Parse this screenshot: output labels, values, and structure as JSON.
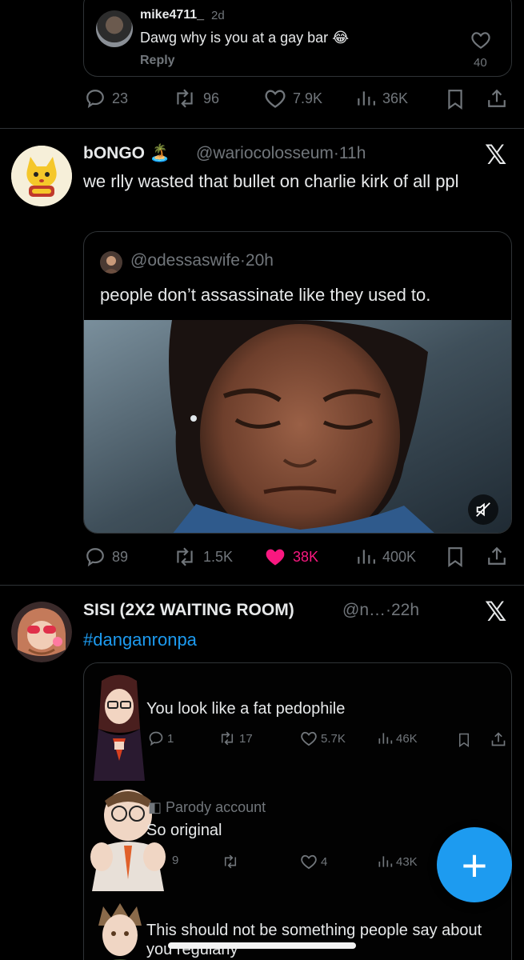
{
  "reply": {
    "username": "mike4711_",
    "time": "2d",
    "text": "Dawg why is you at a gay bar 😂",
    "reply_label": "Reply",
    "likes": "40"
  },
  "tweet0_actions": {
    "replies": "23",
    "reposts": "96",
    "likes": "7.9K",
    "views": "36K"
  },
  "tweet1": {
    "name": "bONGO 🏝️",
    "handle": "@wariocolosseum",
    "dot": "·",
    "time": "11h",
    "text": "we rlly wasted that bullet on charlie kirk of all ppl",
    "quote": {
      "handle": "@odessaswife",
      "dot": "·",
      "time": "20h",
      "text": "people don’t assassinate like they used to."
    },
    "actions": {
      "replies": "89",
      "reposts": "1.5K",
      "likes": "38K",
      "views": "400K"
    },
    "liked_color": "#f91880"
  },
  "tweet2": {
    "name": "SISI (2X2 WAITING ROOM)",
    "handle": "@n…",
    "dot": "·",
    "time": "22h",
    "hashtag": "#danganronpa",
    "hashtag_color": "#1d9bf0",
    "media": {
      "post1": {
        "text": "You look like a fat pedophile",
        "replies": "1",
        "reposts": "17",
        "likes": "5.7K",
        "views": "46K"
      },
      "post2": {
        "badge": "Parody account",
        "text": "So original",
        "replies": "9",
        "likes": "4",
        "views": "43K"
      },
      "post3": {
        "text": "This should not be something people say about you regularly"
      }
    }
  },
  "fab": {
    "icon": "plus-icon",
    "label": "+"
  },
  "colors": {
    "accent": "#1d9bf0",
    "like": "#f91880",
    "muted": "#71767b"
  }
}
